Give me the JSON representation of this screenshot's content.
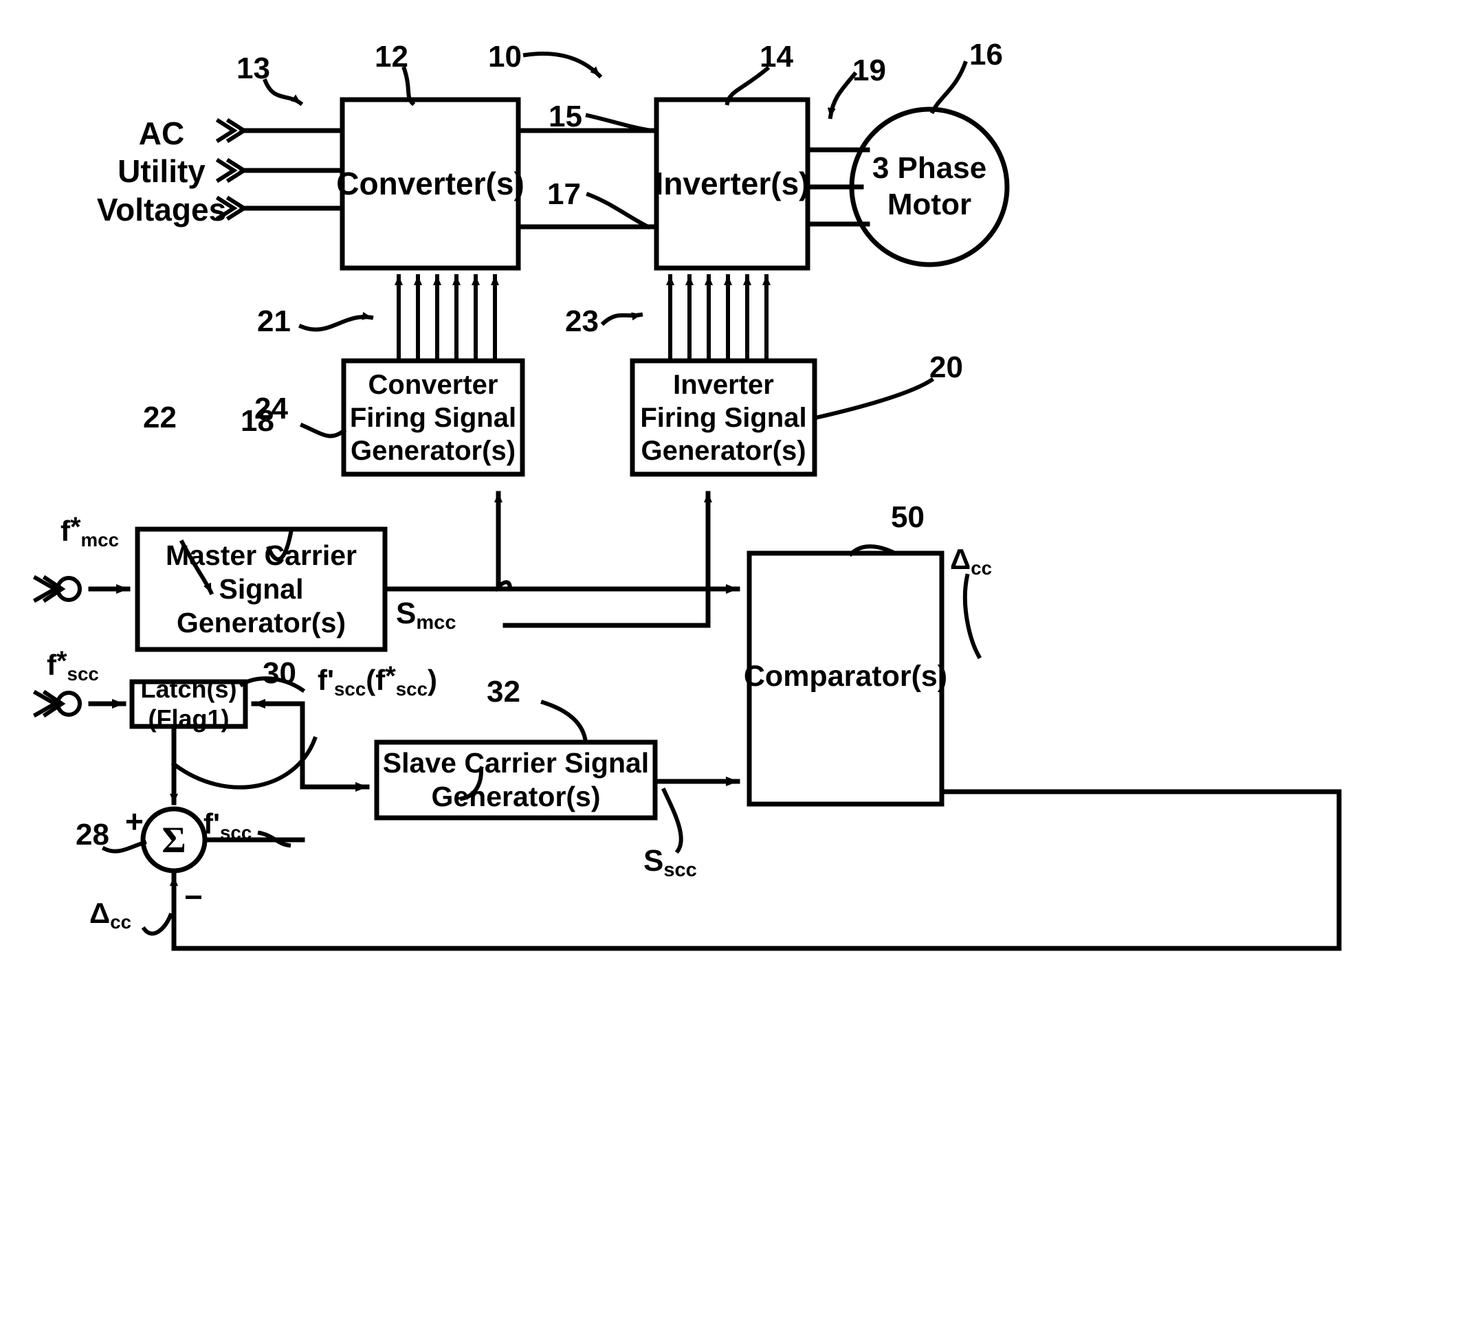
{
  "figure": {
    "type": "patent-block-diagram",
    "background": "#ffffff",
    "stroke": "#000000"
  },
  "labels": {
    "ac_utility": "AC\nUtility\nVoltages",
    "converter": "Converter(s)",
    "inverter": "Inverter(s)",
    "motor": "3 Phase\nMotor",
    "converter_fsg": "Converter\nFiring Signal\nGenerator(s)",
    "inverter_fsg": "Inverter\nFiring Signal\nGenerator(s)",
    "master_csg": "Master Carrier\nSignal\nGenerator(s)",
    "slave_csg": "Slave Carrier Signal\nGenerator(s)",
    "latch": "Latch(s)\n(Flag1)",
    "comparator": "Comparator(s)",
    "sigma": "Σ"
  },
  "reference_numerals": {
    "n10": "10",
    "n12": "12",
    "n13": "13",
    "n14": "14",
    "n15": "15",
    "n16": "16",
    "n17": "17",
    "n18": "18",
    "n19": "19",
    "n20": "20",
    "n21": "21",
    "n22": "22",
    "n23": "23",
    "n24": "24",
    "n28": "28",
    "n30": "30",
    "n32": "32",
    "n50": "50"
  },
  "signals": {
    "f_star_mcc": {
      "base": "f",
      "star": "*",
      "sub": "mcc"
    },
    "f_star_scc": {
      "base": "f",
      "star": "*",
      "sub": "scc"
    },
    "f_prime_scc_of_f_star_scc": {
      "text": "f'scc(f*scc)"
    },
    "f_prime_scc": {
      "base": "f'",
      "sub": "scc"
    },
    "s_mcc": {
      "base": "S",
      "sub": "mcc"
    },
    "s_scc": {
      "base": "S",
      "sub": "scc"
    },
    "delta_cc_right": {
      "base": "Δ",
      "sub": "cc"
    },
    "delta_cc_left": {
      "base": "Δ",
      "sub": "cc"
    },
    "plus": "+",
    "minus": "−"
  }
}
